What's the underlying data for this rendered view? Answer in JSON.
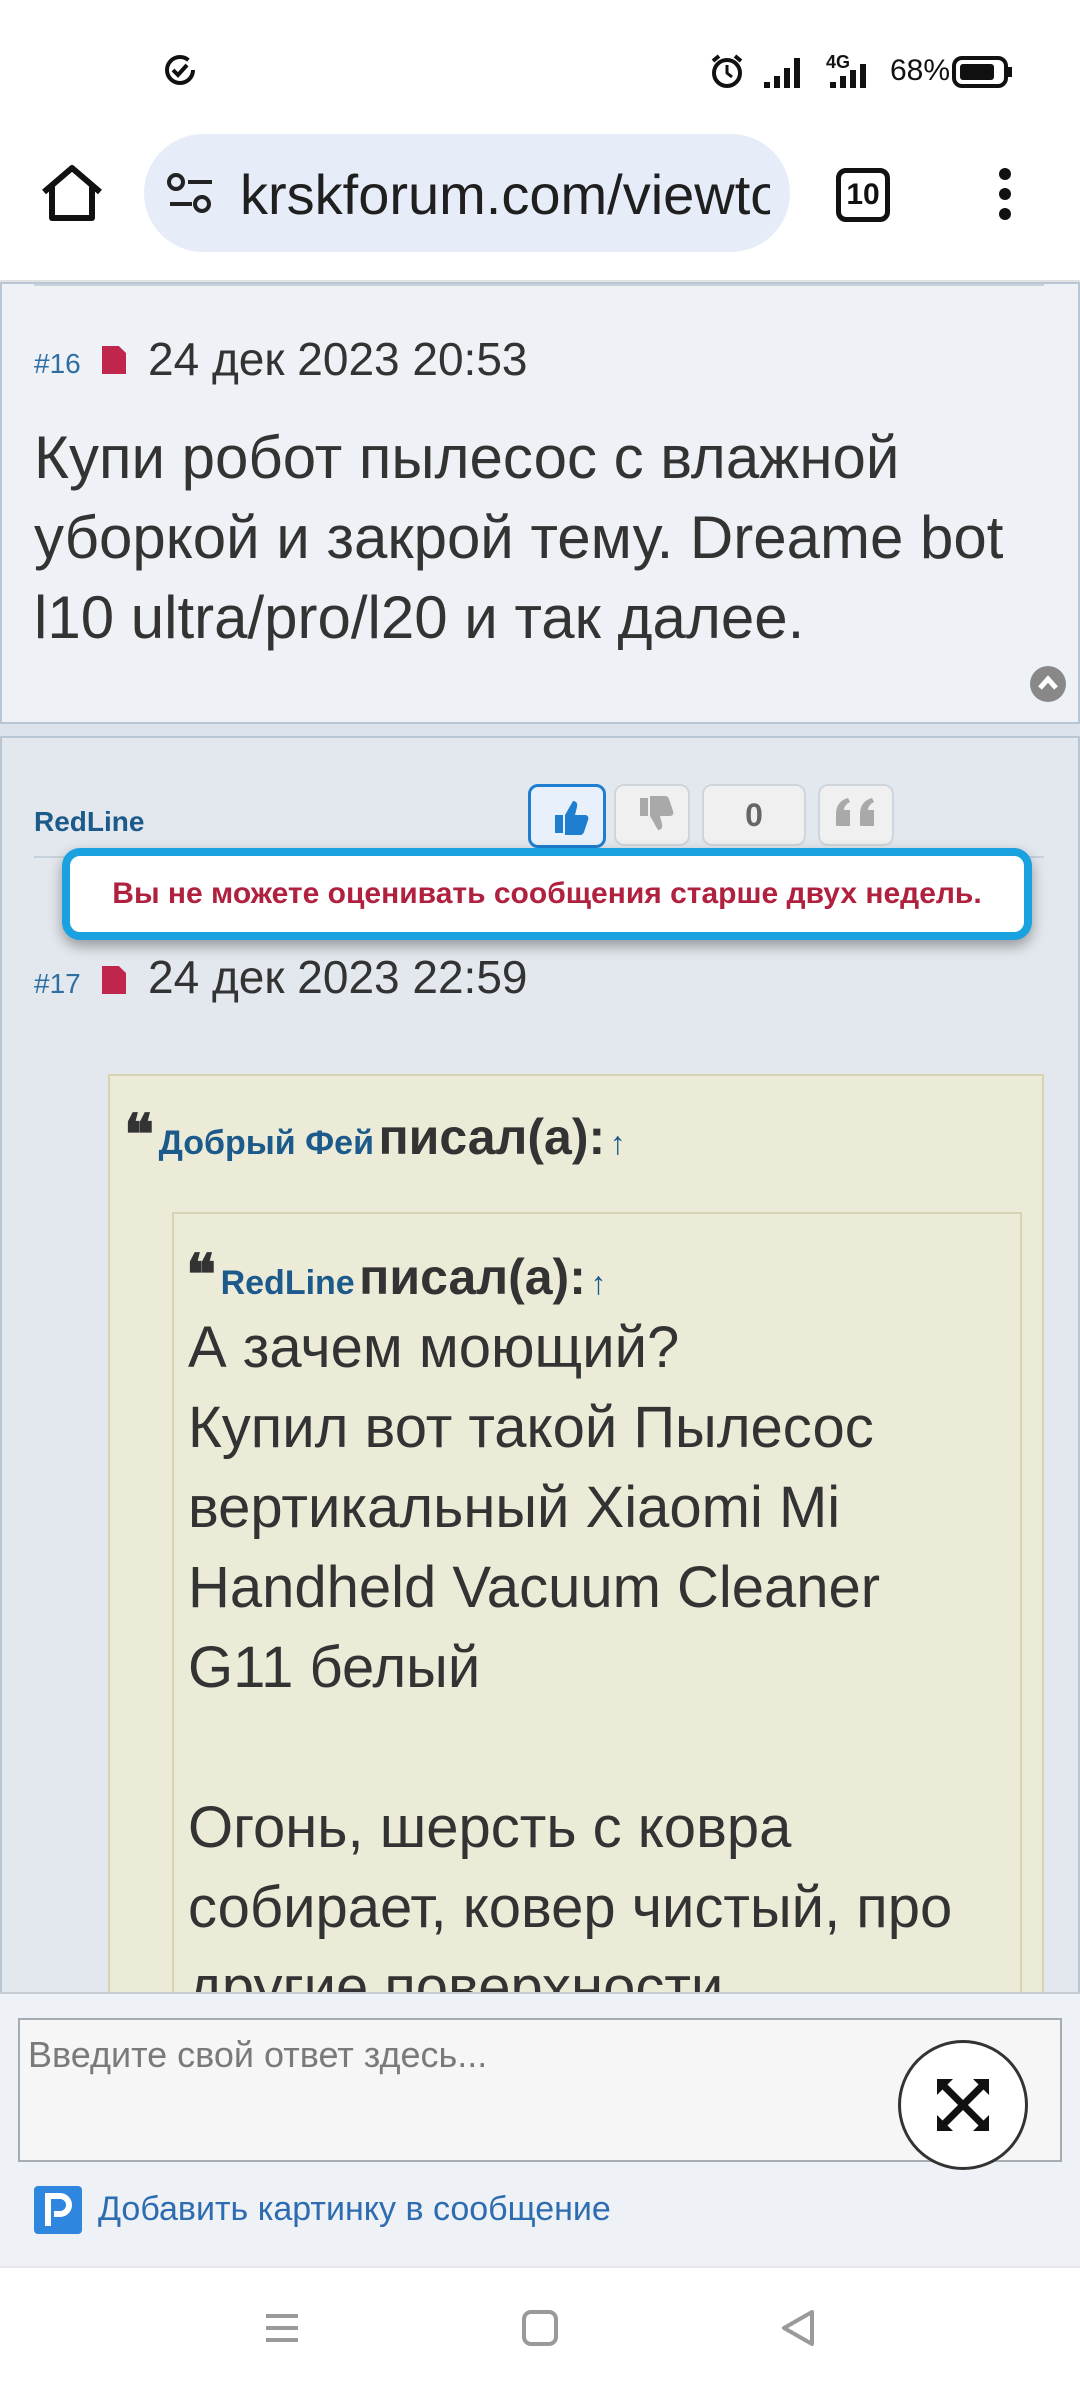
{
  "status_bar": {
    "battery_percent": "68%",
    "network": "4G"
  },
  "browser": {
    "url": "krskforum.com/viewtopic",
    "tab_count": "10"
  },
  "posts": [
    {
      "number": "#16",
      "date": "24 дек 2023 20:53",
      "body": "Купи робот пылесос с влажной уборкой и закрой тему. Dreame bot l10 ultra/pro/l20 и так далее."
    },
    {
      "author": "RedLine",
      "number": "#17",
      "date": "24 дек 2023 22:59",
      "votes": "0",
      "tooltip": "Вы не можете оценивать сообщения старше двух недель.",
      "quote_outer": {
        "author": "Добрый Фей",
        "wrote": "писал(а):",
        "arrow": "↑"
      },
      "quote_inner": {
        "author": "RedLine",
        "wrote": "писал(а):",
        "arrow": "↑",
        "text": "А зачем моющий?\nКупил вот такой Пылесос вертикальный Xiaomi Mi Handheld Vacuum Cleaner G11 белый\n\nОгонь, шерсть с ковра собирает, ковер чистый, про другие поверхности"
      }
    }
  ],
  "reply": {
    "placeholder": "Введите свой ответ здесь...",
    "add_image_label": "Добавить картинку в сообщение"
  },
  "icons": {
    "status_left": "check-circle-icon",
    "home": "home-icon",
    "site_settings": "tune-icon",
    "menu": "more-vert-icon",
    "like": "thumb-up-icon",
    "dislike": "thumb-down-icon",
    "quote": "quote-icon",
    "scroll_top": "chevron-up-icon",
    "expand": "expand-icon",
    "add_image": "image-upload-icon"
  },
  "colors": {
    "accent": "#1aa1e0",
    "tooltip_text": "#b0213f",
    "link": "#1b5a8a"
  }
}
